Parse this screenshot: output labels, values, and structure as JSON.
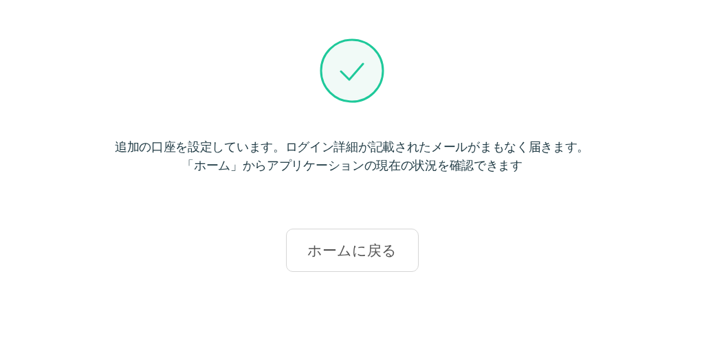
{
  "message_lines": [
    "追加の口座を設定しています。ログイン詳細が記載されたメールがまもなく届きます。",
    "「ホーム」からアプリケーションの現在の状況を確認できます"
  ],
  "button": {
    "label": "ホームに戻る"
  }
}
